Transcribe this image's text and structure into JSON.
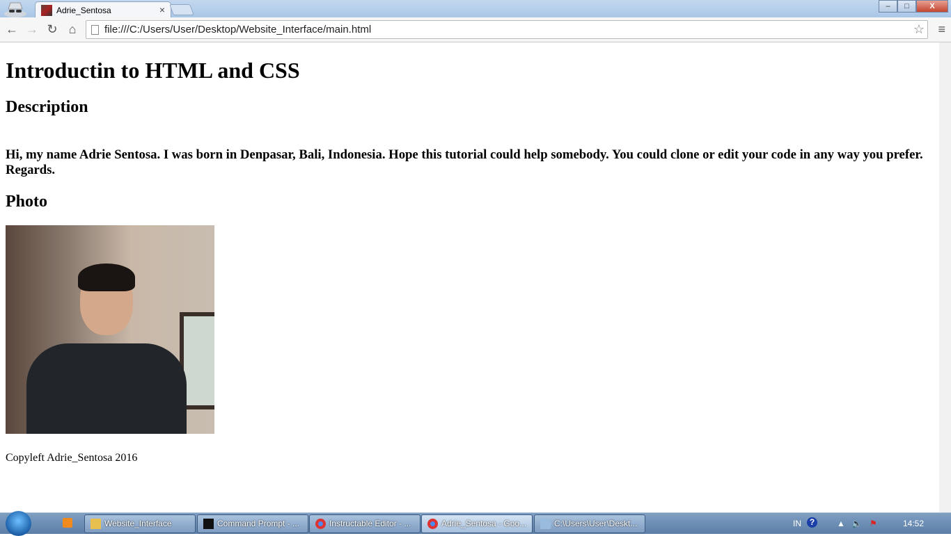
{
  "browser": {
    "tab_title": "Adrie_Sentosa",
    "tab_close": "×",
    "url": "file:///C:/Users/User/Desktop/Website_Interface/main.html",
    "window_buttons": [
      "–",
      "□",
      "X"
    ]
  },
  "page": {
    "title": "Introductin to HTML and CSS",
    "description_heading": "Description",
    "description_text": "Hi, my name Adrie Sentosa. I was born in Denpasar, Bali, Indonesia. Hope this tutorial could help somebody. You could clone or edit your code in any way you prefer. Regards.",
    "photo_heading": "Photo",
    "footer": "Copyleft Adrie_Sentosa 2016"
  },
  "taskbar": {
    "items": [
      {
        "label": "Website_Interface",
        "icon": "folder-icon",
        "color": "#e8c050"
      },
      {
        "label": "Command Prompt - ...",
        "icon": "cmd-icon",
        "color": "#111111"
      },
      {
        "label": "Instructable Editor - ...",
        "icon": "chrome-icon",
        "color": "#d33"
      },
      {
        "label": "Adrie_Sentosa - Goo...",
        "icon": "chrome-icon",
        "color": "#d33"
      },
      {
        "label": "C:\\Users\\User\\Deskt...",
        "icon": "notepad-icon",
        "color": "#9bd"
      }
    ],
    "lang": "IN",
    "clock": "14:52"
  }
}
